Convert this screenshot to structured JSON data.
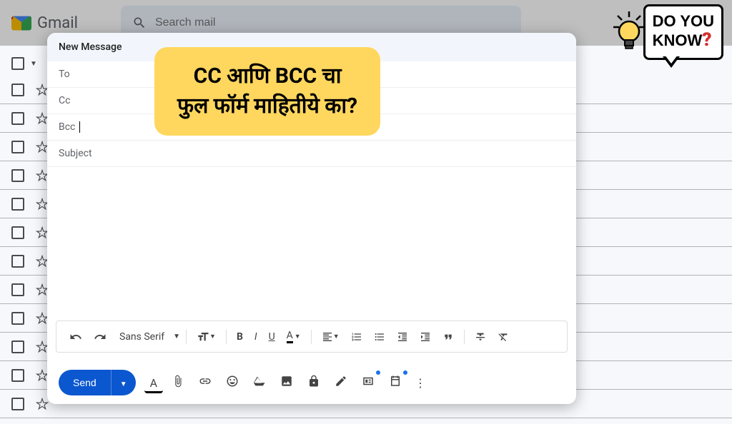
{
  "header": {
    "app_name": "Gmail",
    "search_placeholder": "Search mail"
  },
  "compose": {
    "title": "New Message",
    "fields": {
      "to": "To",
      "cc": "Cc",
      "bcc": "Bcc",
      "subject": "Subject"
    },
    "toolbar": {
      "font": "Sans Serif"
    },
    "send": "Send"
  },
  "callout": {
    "line1": "CC आणि BCC चा",
    "line2": "फुल फॉर्म माहितीये का?"
  },
  "dyk": {
    "line1": "DO YOU",
    "line2": "KNOW",
    "q": "?"
  },
  "mail_rows_count": 13
}
